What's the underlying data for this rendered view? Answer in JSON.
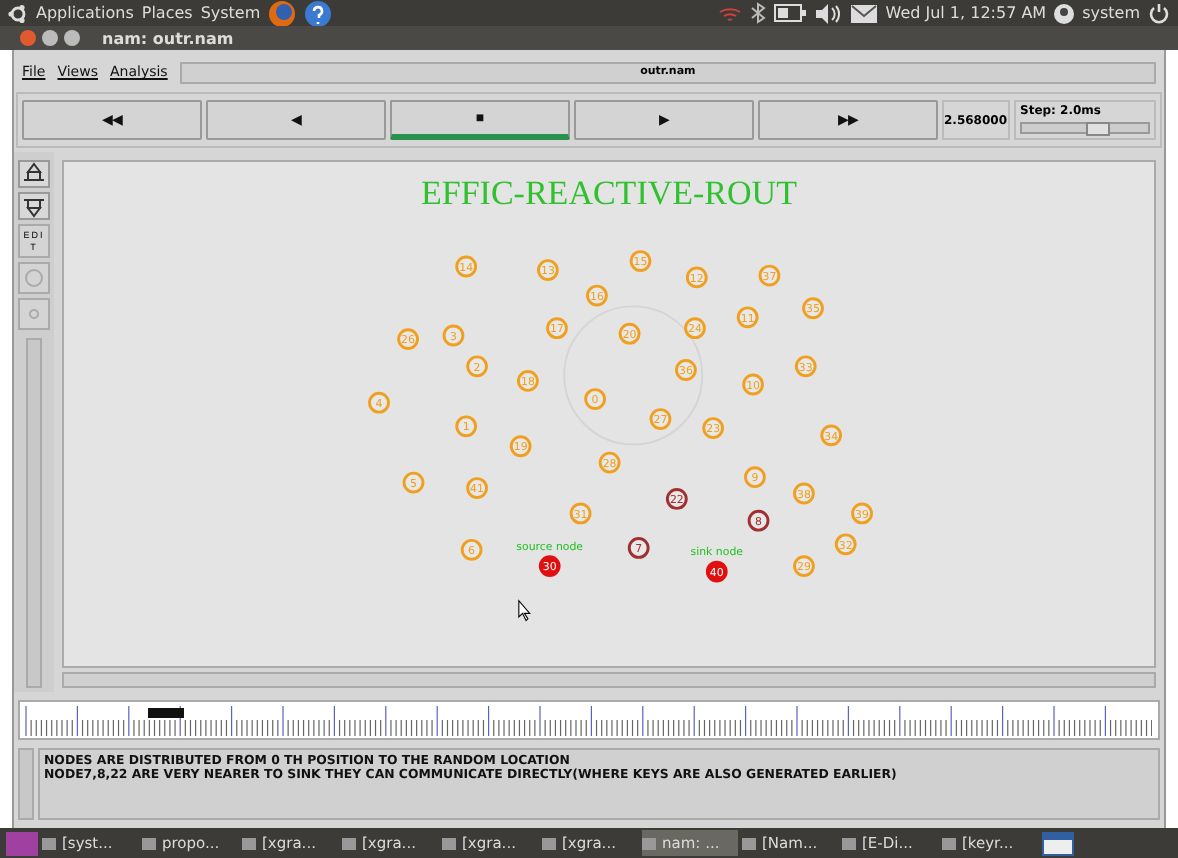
{
  "top_panel": {
    "menus": [
      "Applications",
      "Places",
      "System"
    ],
    "clock": "Wed Jul  1, 12:57 AM",
    "user": "system"
  },
  "window": {
    "title": "nam: outr.nam"
  },
  "menu": [
    "File",
    "Views",
    "Analysis"
  ],
  "file_label": "outr.nam",
  "transport": [
    {
      "glyph": "◀◀",
      "selected": false
    },
    {
      "glyph": "◀",
      "selected": false
    },
    {
      "glyph": "■",
      "selected": true
    },
    {
      "glyph": "▶",
      "selected": false
    },
    {
      "glyph": "▶▶",
      "selected": false
    }
  ],
  "time": "2.568000",
  "step": {
    "label": "Step: 2.0ms",
    "level": 0.6
  },
  "edit_tool": "EDIT",
  "canvas": {
    "title": "EFFIC-REACTIVE-ROUT",
    "nodes": [
      {
        "label": "14",
        "color": "#f0a020"
      },
      {
        "label": "13",
        "color": "#f0a020"
      },
      {
        "label": "15",
        "color": "#f0a020"
      },
      {
        "label": "12",
        "color": "#f0a020"
      },
      {
        "label": "37",
        "color": "#f0a020"
      },
      {
        "label": "16",
        "color": "#f0a020"
      },
      {
        "label": "35",
        "color": "#f0a020"
      },
      {
        "label": "26",
        "color": "#f0a020"
      },
      {
        "label": "3",
        "color": "#f0a020"
      },
      {
        "label": "17",
        "color": "#f0a020"
      },
      {
        "label": "20",
        "color": "#f0a020"
      },
      {
        "label": "24",
        "color": "#f0a020"
      },
      {
        "label": "11",
        "color": "#f0a020"
      },
      {
        "label": "2",
        "color": "#f0a020"
      },
      {
        "label": "18",
        "color": "#f0a020"
      },
      {
        "label": "36",
        "color": "#f0a020"
      },
      {
        "label": "10",
        "color": "#f0a020"
      },
      {
        "label": "33",
        "color": "#f0a020"
      },
      {
        "label": "4",
        "color": "#f0a020"
      },
      {
        "label": "0",
        "color": "#f0a020"
      },
      {
        "label": "27",
        "color": "#f0a020"
      },
      {
        "label": "23",
        "color": "#f0a020"
      },
      {
        "label": "1",
        "color": "#f0a020"
      },
      {
        "label": "19",
        "color": "#f0a020"
      },
      {
        "label": "34",
        "color": "#f0a020"
      },
      {
        "label": "28",
        "color": "#f0a020"
      },
      {
        "label": "5",
        "color": "#f0a020"
      },
      {
        "label": "41",
        "color": "#f0a020"
      },
      {
        "label": "9",
        "color": "#f0a020"
      },
      {
        "label": "22",
        "color": "#a03030"
      },
      {
        "label": "38",
        "color": "#f0a020"
      },
      {
        "label": "31",
        "color": "#f0a020"
      },
      {
        "label": "8",
        "color": "#a03030"
      },
      {
        "label": "39",
        "color": "#f0a020"
      },
      {
        "label": "6",
        "color": "#f0a020"
      },
      {
        "label": "7",
        "color": "#a03030"
      },
      {
        "label": "32",
        "color": "#f0a020"
      },
      {
        "label": "30",
        "color": "#e01010"
      },
      {
        "label": "40",
        "color": "#e01010"
      },
      {
        "label": "29",
        "color": "#f0a020"
      }
    ],
    "tags": [
      "source node",
      "sink node"
    ]
  },
  "annotation": [
    "NODES ARE DISTRIBUTED FROM 0 TH POSITION TO THE RANDOM LOCATION",
    "NODE7,8,22 ARE VERY NEARER TO SINK THEY CAN COMMUNICATE DIRECTLY(WHERE KEYS ARE ALSO GENERATED EARLIER)"
  ],
  "taskbar": [
    {
      "label": "[syst...",
      "selected": false
    },
    {
      "label": "propo...",
      "selected": false
    },
    {
      "label": "[xgra...",
      "selected": false
    },
    {
      "label": "[xgra...",
      "selected": false
    },
    {
      "label": "[xgra...",
      "selected": false
    },
    {
      "label": "[xgra...",
      "selected": false
    },
    {
      "label": "nam: ...",
      "selected": true
    },
    {
      "label": "[Nam...",
      "selected": false
    },
    {
      "label": "[E-Di...",
      "selected": false
    },
    {
      "label": "[keyr...",
      "selected": false
    }
  ]
}
